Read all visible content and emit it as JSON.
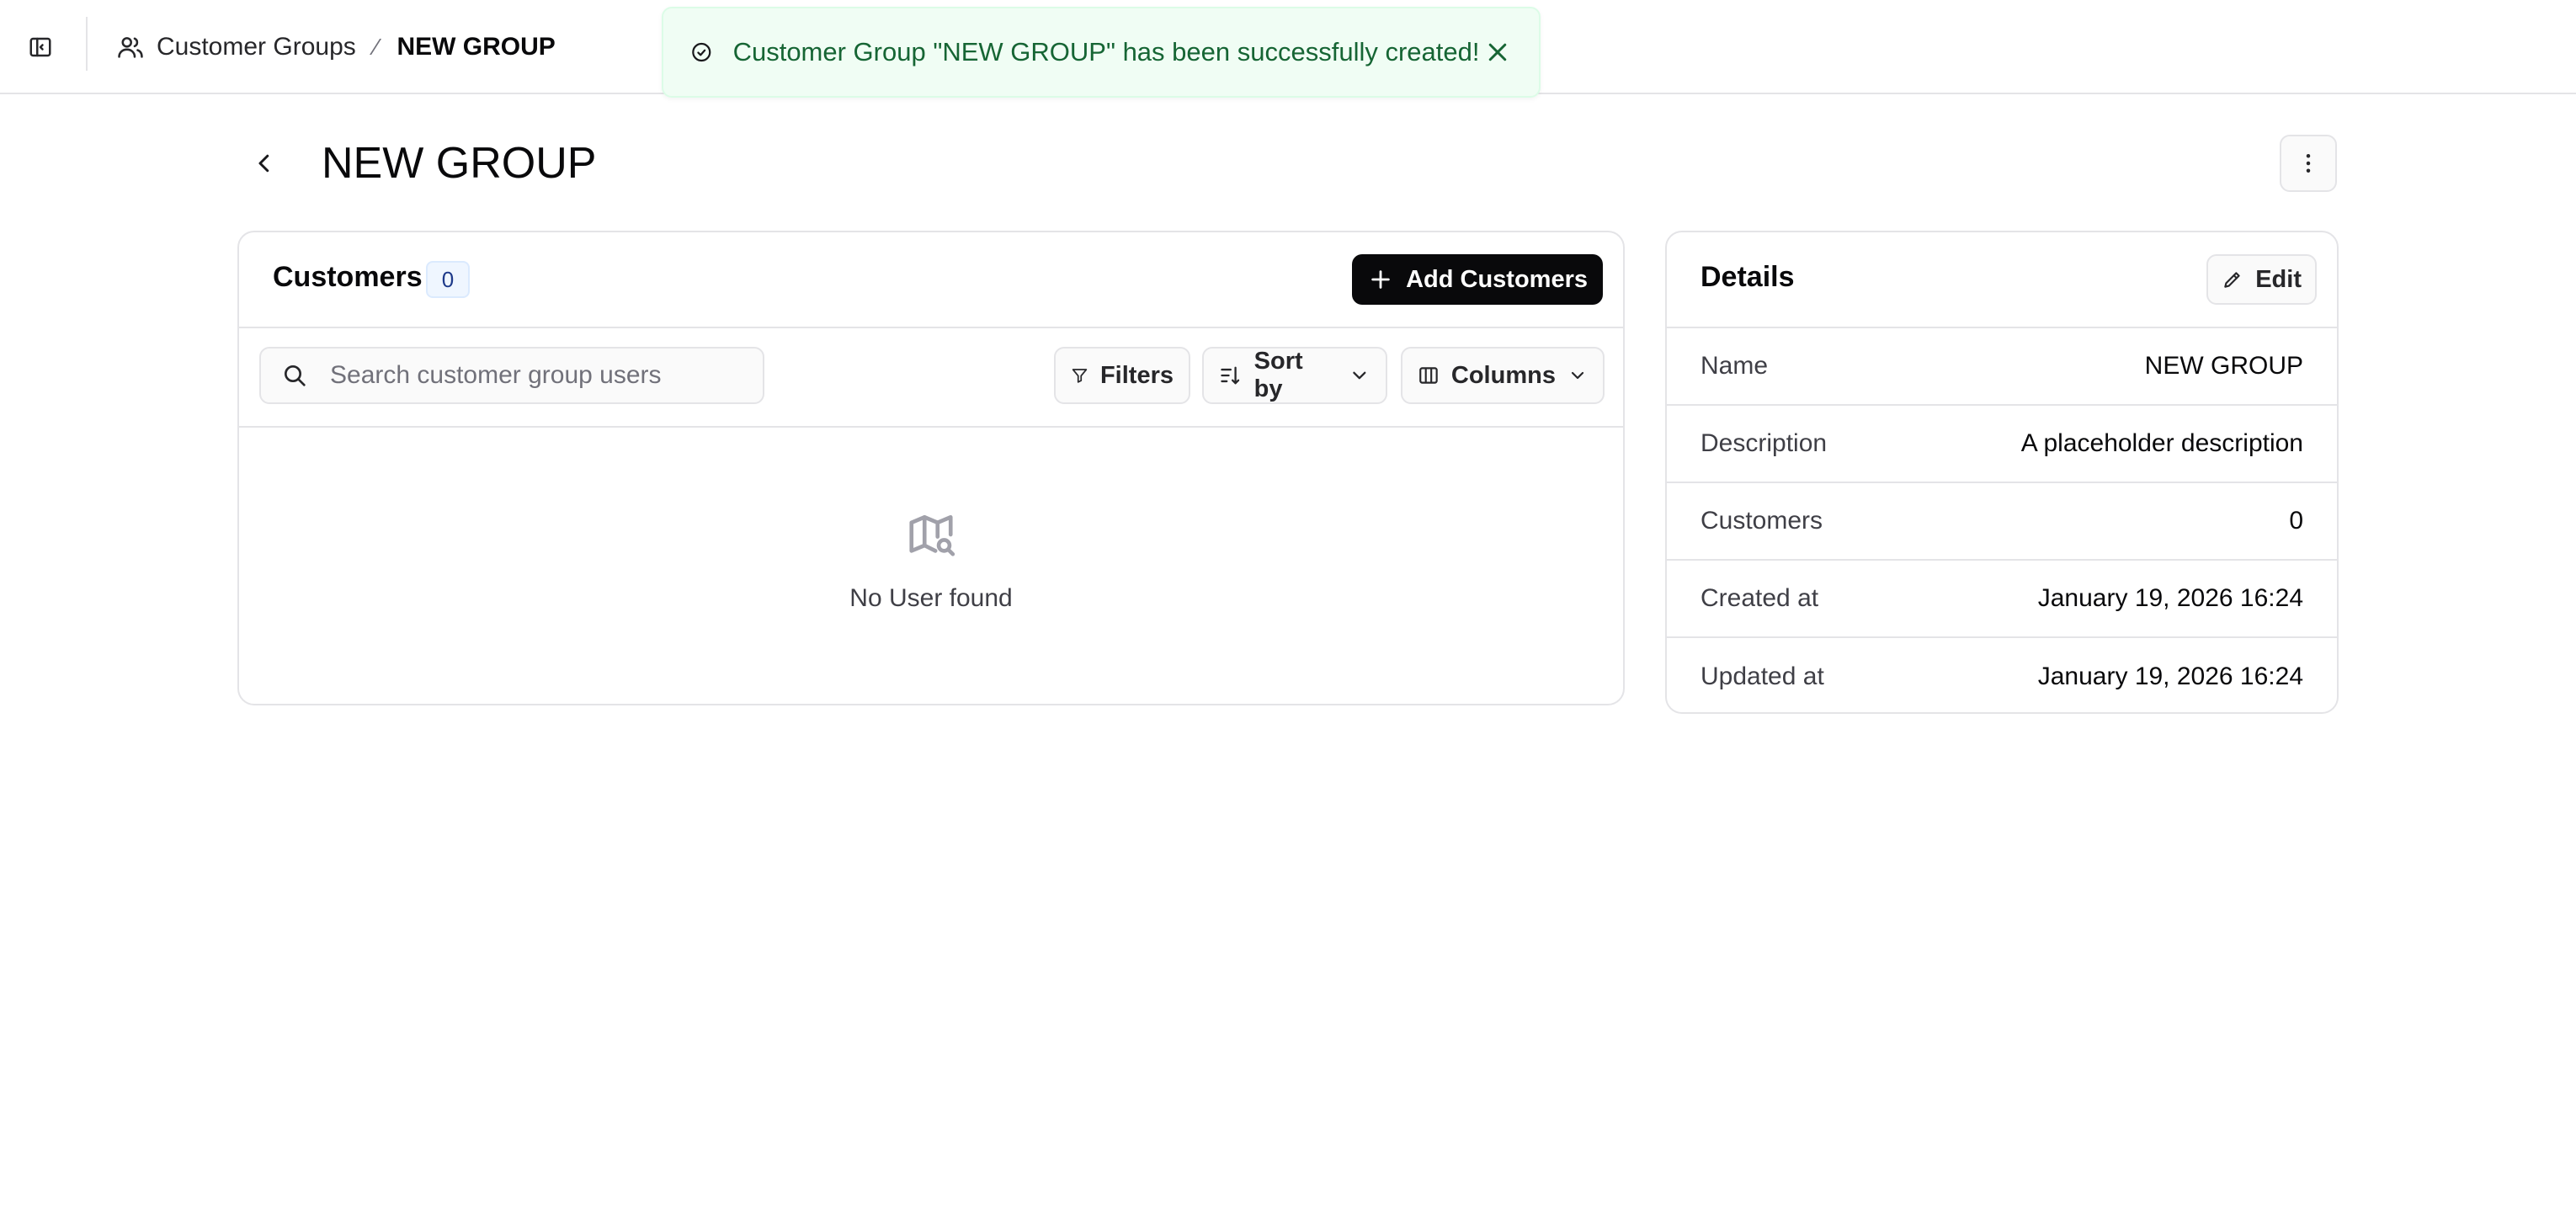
{
  "topbar": {
    "sidebar_toggle_icon": "sidebar-panel-icon",
    "breadcrumb": {
      "section_icon": "users-icon",
      "section_label": "Customer Groups",
      "separator": "⁄",
      "current": "NEW GROUP"
    }
  },
  "toast": {
    "icon": "check-circle-icon",
    "message": "Customer Group \"NEW GROUP\" has been successfully created!",
    "close_icon": "close-icon",
    "accent_color": "#166534"
  },
  "page": {
    "title": "NEW GROUP",
    "back_icon": "chevron-left-icon",
    "more_icon": "more-vertical-icon"
  },
  "customers": {
    "title": "Customers",
    "count": "0",
    "add_button_label": "Add Customers",
    "search_placeholder": "Search customer group users",
    "filters_label": "Filters",
    "sort_label": "Sort by",
    "columns_label": "Columns",
    "empty_icon": "map-search-icon",
    "empty_text": "No User found"
  },
  "details": {
    "title": "Details",
    "edit_label": "Edit",
    "rows": [
      {
        "label": "Name",
        "value": "NEW GROUP"
      },
      {
        "label": "Description",
        "value": "A placeholder description"
      },
      {
        "label": "Customers",
        "value": "0"
      },
      {
        "label": "Created at",
        "value": "January 19, 2026 16:24"
      },
      {
        "label": "Updated at",
        "value": "January 19, 2026 16:24"
      }
    ]
  }
}
